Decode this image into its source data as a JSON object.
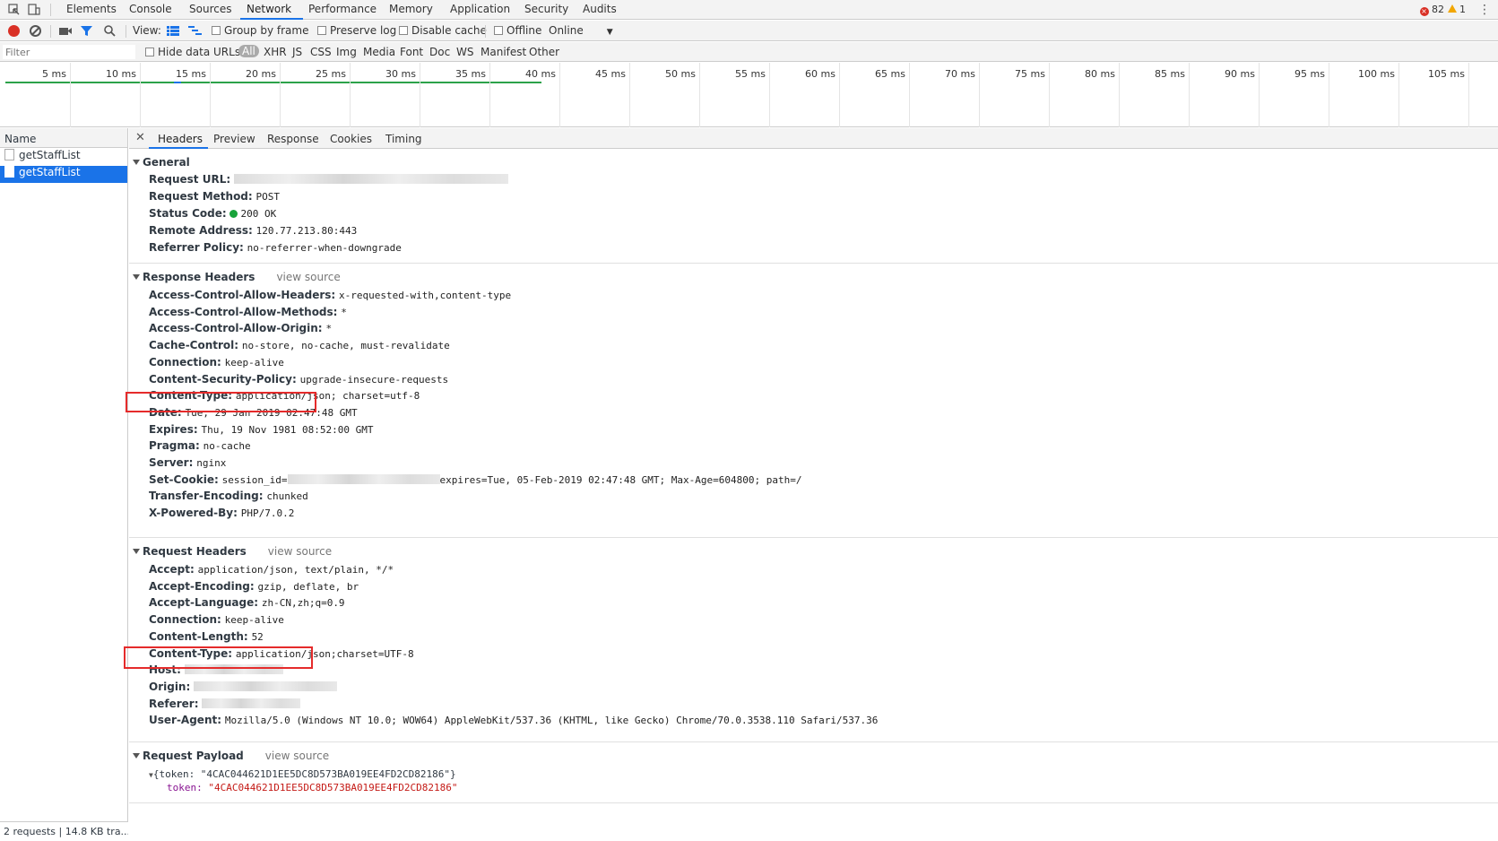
{
  "tabs": [
    "Elements",
    "Console",
    "Sources",
    "Network",
    "Performance",
    "Memory",
    "Application",
    "Security",
    "Audits"
  ],
  "active_tab": "Network",
  "counts": {
    "errors": "82",
    "warnings": "1"
  },
  "toolbar": {
    "view_label": "View:",
    "group_by_frame": "Group by frame",
    "preserve_log": "Preserve log",
    "disable_cache": "Disable cache",
    "offline": "Offline",
    "throttle": "Online"
  },
  "filter": {
    "placeholder": "Filter",
    "hide_data_urls": "Hide data URLs",
    "types": [
      "All",
      "XHR",
      "JS",
      "CSS",
      "Img",
      "Media",
      "Font",
      "Doc",
      "WS",
      "Manifest",
      "Other"
    ]
  },
  "timeline": {
    "ticks": [
      "5 ms",
      "10 ms",
      "15 ms",
      "20 ms",
      "25 ms",
      "30 ms",
      "35 ms",
      "40 ms",
      "45 ms",
      "50 ms",
      "55 ms",
      "60 ms",
      "65 ms",
      "70 ms",
      "75 ms",
      "80 ms",
      "85 ms",
      "90 ms",
      "95 ms",
      "100 ms",
      "105 ms"
    ]
  },
  "requests": {
    "header": "Name",
    "items": [
      "getStaffList",
      "getStaffList"
    ],
    "status": "2 requests | 14.8 KB tra..."
  },
  "detail_tabs": [
    "Headers",
    "Preview",
    "Response",
    "Cookies",
    "Timing"
  ],
  "general": {
    "title": "General",
    "rows": [
      {
        "k": "Request URL:",
        "v": ""
      },
      {
        "k": "Request Method:",
        "v": "POST"
      },
      {
        "k": "Status Code:",
        "v": "200 OK"
      },
      {
        "k": "Remote Address:",
        "v": "120.77.213.80:443"
      },
      {
        "k": "Referrer Policy:",
        "v": "no-referrer-when-downgrade"
      }
    ]
  },
  "response_headers": {
    "title": "Response Headers",
    "view_source": "view source",
    "rows": [
      {
        "k": "Access-Control-Allow-Headers:",
        "v": "x-requested-with,content-type"
      },
      {
        "k": "Access-Control-Allow-Methods:",
        "v": "*"
      },
      {
        "k": "Access-Control-Allow-Origin:",
        "v": "*"
      },
      {
        "k": "Cache-Control:",
        "v": "no-store, no-cache, must-revalidate"
      },
      {
        "k": "Connection:",
        "v": "keep-alive"
      },
      {
        "k": "Content-Security-Policy:",
        "v": "upgrade-insecure-requests"
      },
      {
        "k": "Content-Type:",
        "v": "application/json; charset=utf-8"
      },
      {
        "k": "Date:",
        "v": "Tue, 29 Jan 2019 02:47:48 GMT"
      },
      {
        "k": "Expires:",
        "v": "Thu, 19 Nov 1981 08:52:00 GMT"
      },
      {
        "k": "Pragma:",
        "v": "no-cache"
      },
      {
        "k": "Server:",
        "v": "nginx"
      },
      {
        "k": "Set-Cookie:",
        "v": "session_id=",
        "v2": "expires=Tue, 05-Feb-2019 02:47:48 GMT; Max-Age=604800; path=/"
      },
      {
        "k": "Transfer-Encoding:",
        "v": "chunked"
      },
      {
        "k": "X-Powered-By:",
        "v": "PHP/7.0.2"
      }
    ]
  },
  "request_headers": {
    "title": "Request Headers",
    "view_source": "view source",
    "rows": [
      {
        "k": "Accept:",
        "v": "application/json, text/plain, */*"
      },
      {
        "k": "Accept-Encoding:",
        "v": "gzip, deflate, br"
      },
      {
        "k": "Accept-Language:",
        "v": "zh-CN,zh;q=0.9"
      },
      {
        "k": "Connection:",
        "v": "keep-alive"
      },
      {
        "k": "Content-Length:",
        "v": "52"
      },
      {
        "k": "Content-Type:",
        "v": "application/json;charset=UTF-8"
      },
      {
        "k": "Host:",
        "v": ""
      },
      {
        "k": "Origin:",
        "v": ""
      },
      {
        "k": "Referer:",
        "v": ""
      },
      {
        "k": "User-Agent:",
        "v": "Mozilla/5.0 (Windows NT 10.0; WOW64) AppleWebKit/537.36 (KHTML, like Gecko) Chrome/70.0.3538.110 Safari/537.36"
      }
    ]
  },
  "payload": {
    "title": "Request Payload",
    "view_source": "view source",
    "summary": "{token: \"4CAC044621D1EE5DC8D573BA019EE4FD2CD82186\"}",
    "key": "token:",
    "value": "\"4CAC044621D1EE5DC8D573BA019EE4FD2CD82186\""
  }
}
